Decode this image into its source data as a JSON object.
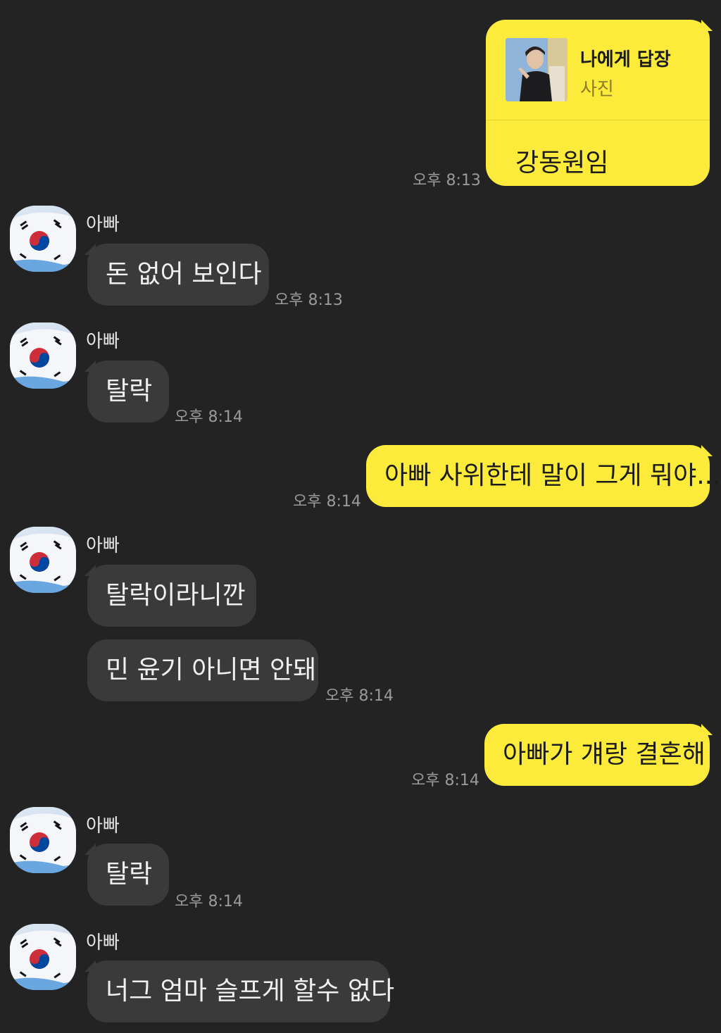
{
  "colors": {
    "background": "#232323",
    "incoming_bubble": "#3a3a3a",
    "outgoing_bubble": "#fdeb3b",
    "timestamp": "#9a9a9a"
  },
  "messages": [
    {
      "direction": "outgoing",
      "reply": {
        "title": "나에게 답장",
        "subtitle": "사진",
        "thumbnail": "photo-thumbnail"
      },
      "text": "강동원임",
      "time": "오후 8:13"
    },
    {
      "direction": "incoming",
      "sender": "아빠",
      "avatar": "korean-flag-avatar",
      "text": "돈 없어 보인다",
      "time": "오후 8:13"
    },
    {
      "direction": "incoming",
      "sender": "아빠",
      "avatar": "korean-flag-avatar",
      "text": "탈락",
      "time": "오후 8:14"
    },
    {
      "direction": "outgoing",
      "text": "아빠 사위한테 말이 그게 뭐야...",
      "time": "오후 8:14"
    },
    {
      "direction": "incoming",
      "sender": "아빠",
      "avatar": "korean-flag-avatar",
      "text": "탈락이라니깐"
    },
    {
      "direction": "incoming",
      "text": "민 윤기 아니면 안돼",
      "time": "오후 8:14"
    },
    {
      "direction": "outgoing",
      "text": "아빠가 걔랑 결혼해",
      "time": "오후 8:14"
    },
    {
      "direction": "incoming",
      "sender": "아빠",
      "avatar": "korean-flag-avatar",
      "text": "탈락",
      "time": "오후 8:14"
    },
    {
      "direction": "incoming",
      "sender": "아빠",
      "avatar": "korean-flag-avatar",
      "text": "너그 엄마 슬프게 할수 없다"
    }
  ]
}
